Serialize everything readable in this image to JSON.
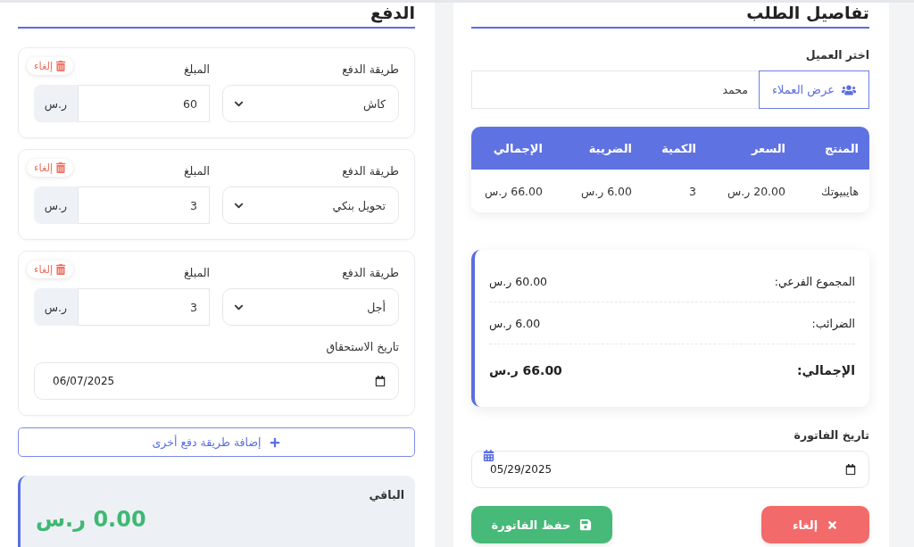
{
  "order": {
    "title": "تفاصيل الطلب",
    "customer_label": "اختر العميل",
    "customers_button": "عرض العملاء",
    "customer_value": "محمد",
    "table": {
      "columns": [
        "المنتج",
        "السعر",
        "الكمية",
        "الضريبة",
        "الإجمالي"
      ],
      "rows": [
        [
          "هايبيوتك",
          "20.00 ر.س",
          "3",
          "6.00 ر.س",
          "66.00 ر.س"
        ]
      ]
    },
    "summary": [
      {
        "label": "المجموع الفرعي:",
        "value": "60.00 ر.س",
        "kind": "normal"
      },
      {
        "label": "الضرائب:",
        "value": "6.00 ر.س",
        "kind": "normal"
      },
      {
        "label": "الإجمالي:",
        "value": "66.00 ر.س",
        "kind": "total"
      }
    ],
    "invoice_date_label": "تاريخ الفاتورة",
    "invoice_date": "05/29/2025",
    "cancel_button": "إلغاء",
    "save_button": "حفظ الفاتورة"
  },
  "payment": {
    "title": "الدفع",
    "items": [
      {
        "method_label": "طريقة الدفع",
        "method": "كاش",
        "amount_label": "المبلغ",
        "amount": "60",
        "currency": "ر.س",
        "remove": "إلغاء"
      },
      {
        "method_label": "طريقة الدفع",
        "method": "تحويل بنكي",
        "amount_label": "المبلغ",
        "amount": "3",
        "currency": "ر.س",
        "remove": "إلغاء"
      },
      {
        "method_label": "طريقة الدفع",
        "method": "أجل",
        "amount_label": "المبلغ",
        "amount": "3",
        "currency": "ر.س",
        "remove": "إلغاء",
        "due_date": {
          "label": "تاريخ الاستحقاق",
          "value": "06/07/2025"
        }
      }
    ],
    "add_button": "إضافة طريقة دفع أخرى",
    "remaining_label": "الباقي",
    "remaining_value": "0.00 ر.س"
  }
}
